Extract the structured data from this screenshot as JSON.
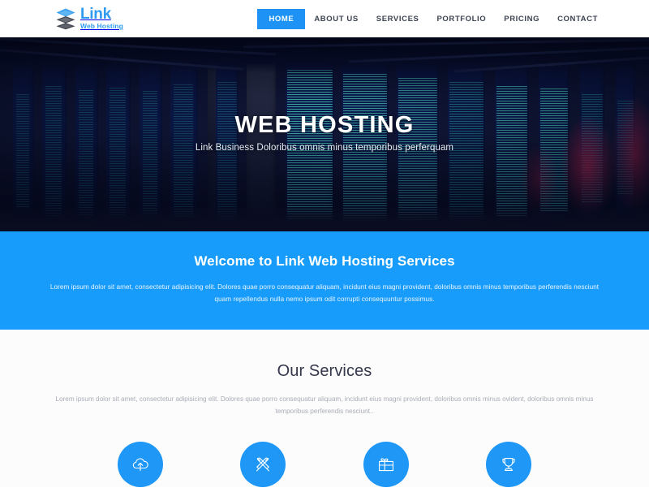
{
  "header": {
    "logo": {
      "icon": "stacked-layers-icon",
      "title": "Link",
      "subtitle": "Web Hosting"
    },
    "nav": [
      {
        "label": "HOME",
        "active": true
      },
      {
        "label": "ABOUT US",
        "active": false
      },
      {
        "label": "SERVICES",
        "active": false
      },
      {
        "label": "PORTFOLIO",
        "active": false
      },
      {
        "label": "PRICING",
        "active": false
      },
      {
        "label": "CONTACT",
        "active": false
      }
    ]
  },
  "hero": {
    "title": "WEB HOSTING",
    "subtitle": "Link Business Doloribus omnis minus temporibus perferquam",
    "background": "data-center-server-racks-photo"
  },
  "welcome": {
    "title": "Welcome to Link Web Hosting Services",
    "text": "Lorem ipsum dolor sit amet, consectetur adipisicing elit. Dolores quae porro consequatur aliquam, incidunt eius magni provident, doloribus omnis minus temporibus perferendis nesciunt quam repellendus nulla nemo ipsum odit corrupti consequuntur possimus."
  },
  "services": {
    "title": "Our Services",
    "text": "Lorem ipsum dolor sit amet, consectetur adipisicing elit. Dolores quae porro consequatur aliquam, incidunt eius magni provident, doloribus omnis minus ovident, doloribus omnis minus temporibus perferendis nesciunt..",
    "items": [
      {
        "icon": "cloud-upload-icon"
      },
      {
        "icon": "pencil-ruler-icon"
      },
      {
        "icon": "gift-box-icon"
      },
      {
        "icon": "trophy-icon"
      }
    ]
  },
  "colors": {
    "accent": "#1e93f5",
    "welcome_band": "#189cfb",
    "icon_circle": "#1e97f7",
    "nav_text": "#3c4451",
    "heading": "#33384a"
  }
}
